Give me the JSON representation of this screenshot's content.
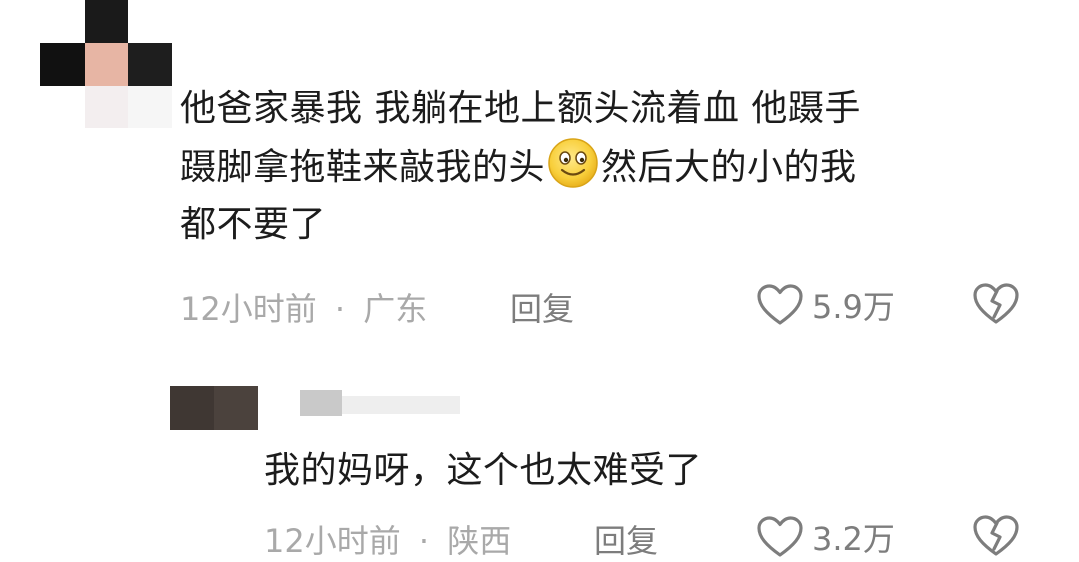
{
  "comments": [
    {
      "text_lines": [
        "他爸家暴我 我躺在地上额头流着血 他蹑手",
        "蹑脚拿拖鞋来敲我的头",
        "然后大的小的我",
        "都不要了"
      ],
      "emoji": "smile-emoji-icon",
      "time": "12小时前",
      "separator": "·",
      "location": "广东",
      "reply_label": "回复",
      "likes": "5.9万"
    },
    {
      "text": "我的妈呀，这个也太难受了",
      "time": "12小时前",
      "separator": "·",
      "location": "陕西",
      "reply_label": "回复",
      "likes": "3.2万"
    }
  ],
  "icons": {
    "like": "heart-outline-icon",
    "dislike": "broken-heart-icon"
  },
  "colors": {
    "text": "#1c1c1c",
    "meta": "#a9a9a9",
    "action": "#7d7d7d"
  }
}
